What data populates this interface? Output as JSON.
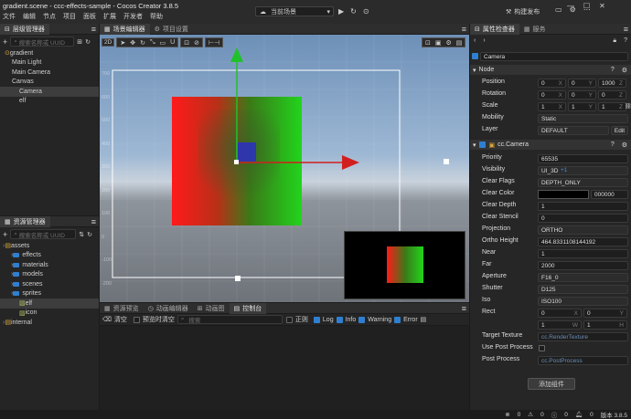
{
  "window": {
    "title": "gradient.scene - ccc-effects-sample - Cocos Creator 3.8.5"
  },
  "menu": [
    "文件",
    "编辑",
    "节点",
    "项目",
    "面板",
    "扩展",
    "开发者",
    "帮助"
  ],
  "toolbar": {
    "scene_select": "当前场景",
    "build_publish": "构建发布"
  },
  "hierarchy": {
    "title": "层级管理器",
    "search_placeholder": "搜索名称或 UUID",
    "nodes": [
      {
        "label": "gradient",
        "depth": 0,
        "selected": false
      },
      {
        "label": "Main Light",
        "depth": 1,
        "selected": false
      },
      {
        "label": "Main Camera",
        "depth": 1,
        "selected": false
      },
      {
        "label": "Canvas",
        "depth": 1,
        "selected": false
      },
      {
        "label": "Camera",
        "depth": 2,
        "selected": true
      },
      {
        "label": "elf",
        "depth": 2,
        "selected": false
      }
    ]
  },
  "assets": {
    "title": "资源管理器",
    "search_placeholder": "搜索名称或 UUID",
    "items": [
      {
        "label": "assets",
        "depth": 0,
        "kind": "db"
      },
      {
        "label": "effects",
        "depth": 1,
        "kind": "folder"
      },
      {
        "label": "materials",
        "depth": 1,
        "kind": "folder"
      },
      {
        "label": "models",
        "depth": 1,
        "kind": "folder"
      },
      {
        "label": "scenes",
        "depth": 1,
        "kind": "folder"
      },
      {
        "label": "sprites",
        "depth": 1,
        "kind": "folder"
      },
      {
        "label": "elf",
        "depth": 2,
        "kind": "image"
      },
      {
        "label": "icon",
        "depth": 2,
        "kind": "image"
      },
      {
        "label": "internal",
        "depth": 0,
        "kind": "db"
      }
    ]
  },
  "scene": {
    "tabs": [
      "场景编辑器",
      "项目设置"
    ],
    "mode": "2D",
    "ruler_labels": [
      "700",
      "600",
      "500",
      "400",
      "300",
      "200",
      "100",
      "0",
      "-100",
      "-200"
    ]
  },
  "bottom": {
    "tabs": [
      "资源预览",
      "动画编辑器",
      "动画图",
      "控制台"
    ],
    "clear": "清空",
    "preview_clear": "预览时清空",
    "search_placeholder": "搜索",
    "regex": "正则",
    "log": "Log",
    "info": "Info",
    "warning": "Warning",
    "error": "Error"
  },
  "inspector": {
    "tabs": [
      "属性检查器",
      "服务"
    ],
    "node_name": "Camera",
    "node_section": "Node",
    "position": {
      "label": "Position",
      "x": "0",
      "y": "0",
      "z": "1000"
    },
    "rotation": {
      "label": "Rotation",
      "x": "0",
      "y": "0",
      "z": "0"
    },
    "scale": {
      "label": "Scale",
      "x": "1",
      "y": "1",
      "z": "1"
    },
    "mobility": {
      "label": "Mobility",
      "value": "Static"
    },
    "layer": {
      "label": "Layer",
      "value": "DEFAULT",
      "edit": "Edit"
    },
    "component": "cc.Camera",
    "props": {
      "priority": {
        "label": "Priority",
        "value": "65535"
      },
      "visibility": {
        "label": "Visibility",
        "value": "UI_3D",
        "extra": "+1"
      },
      "clear_flags": {
        "label": "Clear Flags",
        "value": "DEPTH_ONLY"
      },
      "clear_color": {
        "label": "Clear Color",
        "value": "000000"
      },
      "clear_depth": {
        "label": "Clear Depth",
        "value": "1"
      },
      "clear_stencil": {
        "label": "Clear Stencil",
        "value": "0"
      },
      "projection": {
        "label": "Projection",
        "value": "ORTHO"
      },
      "ortho_height": {
        "label": "Ortho Height",
        "value": "464.8331108144192"
      },
      "near": {
        "label": "Near",
        "value": "1"
      },
      "far": {
        "label": "Far",
        "value": "2000"
      },
      "aperture": {
        "label": "Aperture",
        "value": "F16_0"
      },
      "shutter": {
        "label": "Shutter",
        "value": "D125"
      },
      "iso": {
        "label": "Iso",
        "value": "ISO100"
      },
      "rect": {
        "label": "Rect",
        "x": "0",
        "y": "0",
        "w": "1",
        "h": "1"
      },
      "target_texture": {
        "label": "Target Texture",
        "value": "cc.RenderTexture"
      },
      "use_post_process": {
        "label": "Use Post Process"
      },
      "post_process": {
        "label": "Post Process",
        "value": "cc.PostProcess"
      }
    },
    "add_component": "添加组件"
  },
  "status": {
    "counts": [
      "0",
      "0",
      "0",
      "0"
    ],
    "version": "版本 3.8.5"
  },
  "colors": {
    "accent": "#2f7fd0",
    "gizmo_green": "#21c12b",
    "gizmo_red": "#d11f1f"
  }
}
